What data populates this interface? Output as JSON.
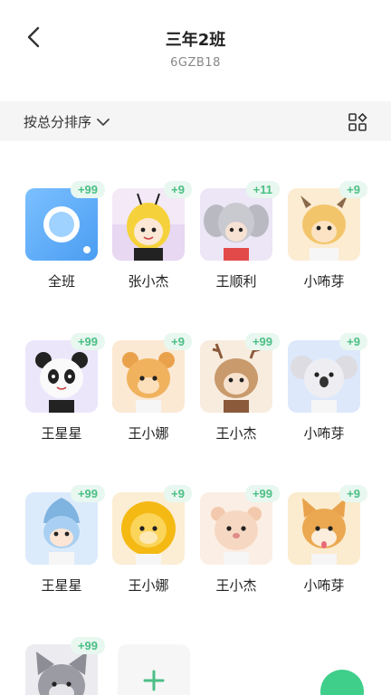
{
  "header": {
    "title": "三年2班",
    "subtitle": "6GZB18"
  },
  "sortbar": {
    "label": "按总分排序"
  },
  "students": [
    {
      "name": "全班",
      "score": "+99",
      "avatar": "whole-class-icon"
    },
    {
      "name": "张小杰",
      "score": "+9",
      "avatar": "bee-avatar"
    },
    {
      "name": "王顺利",
      "score": "+11",
      "avatar": "elephant-avatar"
    },
    {
      "name": "小咘芽",
      "score": "+9",
      "avatar": "cow-avatar"
    },
    {
      "name": "王星星",
      "score": "+99",
      "avatar": "panda-avatar"
    },
    {
      "name": "王小娜",
      "score": "+9",
      "avatar": "bear-avatar"
    },
    {
      "name": "王小杰",
      "score": "+99",
      "avatar": "deer-avatar"
    },
    {
      "name": "小咘芽",
      "score": "+9",
      "avatar": "koala-avatar"
    },
    {
      "name": "王星星",
      "score": "+99",
      "avatar": "dolphin-avatar"
    },
    {
      "name": "王小娜",
      "score": "+9",
      "avatar": "lion-avatar"
    },
    {
      "name": "王小杰",
      "score": "+99",
      "avatar": "hamster-avatar"
    },
    {
      "name": "小咘芽",
      "score": "+9",
      "avatar": "shiba-avatar"
    },
    {
      "name": "",
      "score": "+99",
      "avatar": "wolf-avatar"
    }
  ],
  "colors": {
    "accent": "#4cbf86",
    "badge_bg": "#e8f7ef",
    "sortbar_bg": "#f5f5f5"
  }
}
